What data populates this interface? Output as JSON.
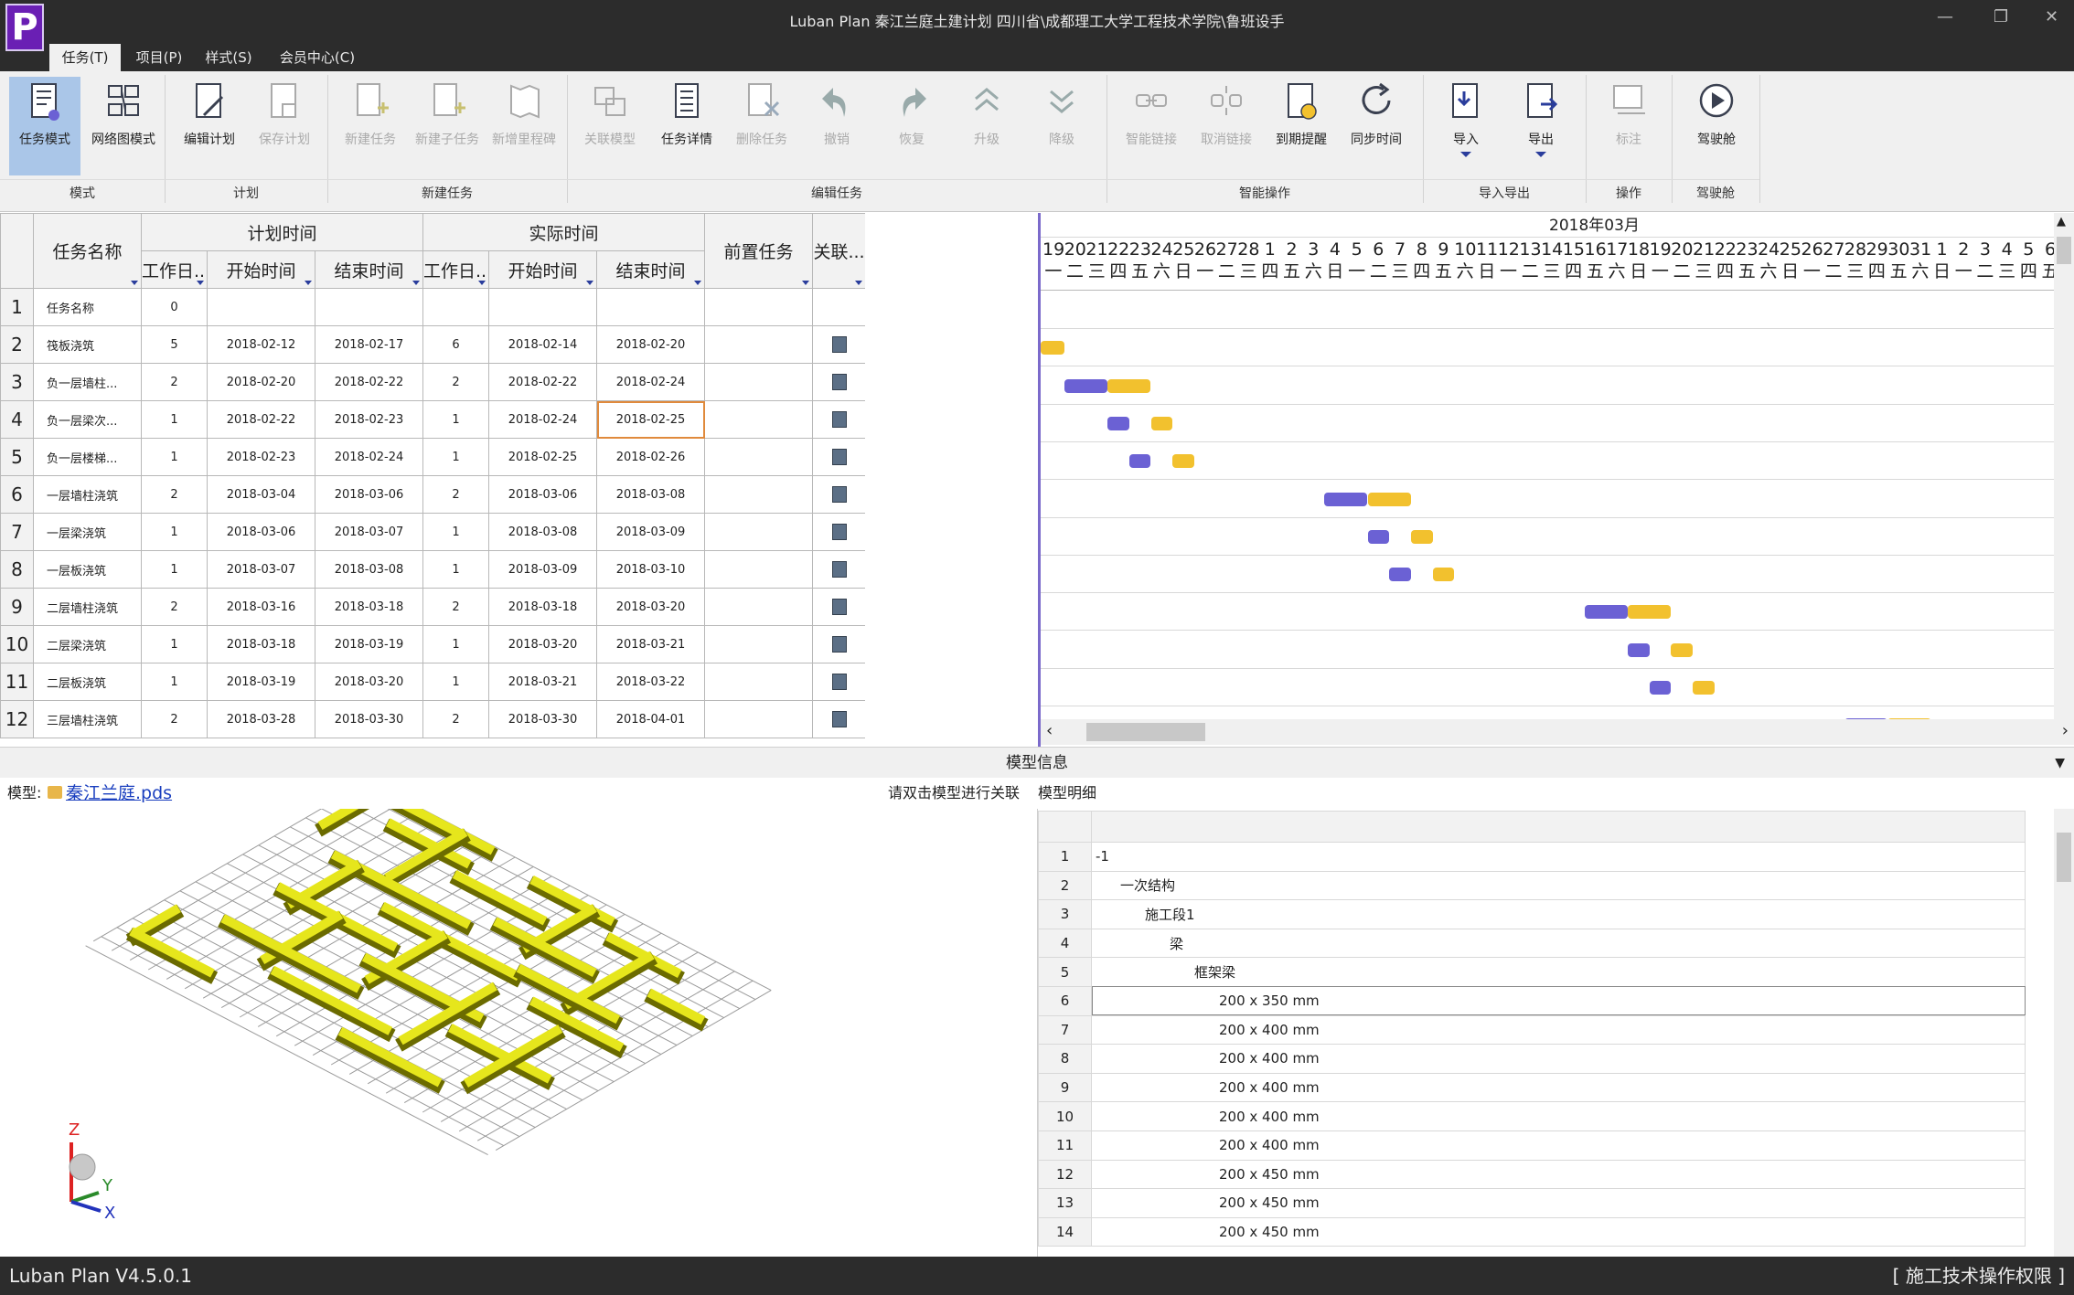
{
  "app": {
    "logo": "P",
    "title": "Luban Plan 秦江兰庭土建计划 四川省\\成都理工大学工程技术学院\\鲁班设手",
    "version": "Luban Plan V4.5.0.1",
    "permission": "[ 施工技术操作权限 ]"
  },
  "window_controls": {
    "minimize": "—",
    "restore": "❐",
    "close": "✕"
  },
  "menu": [
    {
      "label": "任务(T)",
      "active": true
    },
    {
      "label": "项目(P)",
      "active": false
    },
    {
      "label": "样式(S)",
      "active": false
    },
    {
      "label": "会员中心(C)",
      "active": false
    }
  ],
  "ribbon": {
    "buttons": [
      {
        "label": "任务模式",
        "icon": "task-mode-icon",
        "state": "selected"
      },
      {
        "label": "网络图模式",
        "icon": "network-mode-icon",
        "state": "normal"
      },
      {
        "label": "编辑计划",
        "icon": "edit-plan-icon",
        "state": "normal"
      },
      {
        "label": "保存计划",
        "icon": "save-plan-icon",
        "state": "disabled"
      },
      {
        "label": "新建任务",
        "icon": "new-task-icon",
        "state": "disabled"
      },
      {
        "label": "新建子任务",
        "icon": "new-subtask-icon",
        "state": "disabled"
      },
      {
        "label": "新增里程碑",
        "icon": "milestone-icon",
        "state": "disabled"
      },
      {
        "label": "关联模型",
        "icon": "link-model-icon",
        "state": "disabled"
      },
      {
        "label": "任务详情",
        "icon": "task-detail-icon",
        "state": "normal"
      },
      {
        "label": "删除任务",
        "icon": "delete-task-icon",
        "state": "disabled"
      },
      {
        "label": "撤销",
        "icon": "undo-icon",
        "state": "disabled"
      },
      {
        "label": "恢复",
        "icon": "redo-icon",
        "state": "disabled"
      },
      {
        "label": "升级",
        "icon": "promote-icon",
        "state": "disabled"
      },
      {
        "label": "降级",
        "icon": "demote-icon",
        "state": "disabled"
      },
      {
        "label": "智能链接",
        "icon": "smart-link-icon",
        "state": "disabled"
      },
      {
        "label": "取消链接",
        "icon": "unlink-icon",
        "state": "disabled"
      },
      {
        "label": "到期提醒",
        "icon": "due-reminder-icon",
        "state": "normal"
      },
      {
        "label": "同步时间",
        "icon": "sync-time-icon",
        "state": "normal"
      },
      {
        "label": "导入",
        "icon": "import-icon",
        "state": "normal",
        "dropdown": true
      },
      {
        "label": "导出",
        "icon": "export-icon",
        "state": "normal",
        "dropdown": true
      },
      {
        "label": "标注",
        "icon": "annotate-icon",
        "state": "disabled"
      },
      {
        "label": "驾驶舱",
        "icon": "cockpit-icon",
        "state": "normal"
      }
    ],
    "groups": [
      "模式",
      "计划",
      "新建任务",
      "编辑任务",
      "智能操作",
      "导入导出",
      "操作",
      "驾驶舱"
    ]
  },
  "table": {
    "headers": {
      "task_name": "任务名称",
      "plan_time": "计划时间",
      "actual_time": "实际时间",
      "work_days": "工作日...",
      "start_time": "开始时间",
      "end_time": "结束时间",
      "predecessor": "前置任务",
      "linked": "关联..."
    },
    "rows": [
      {
        "no": "1",
        "name": "任务名称",
        "plan_days": "0",
        "plan_start": "",
        "plan_end": "",
        "act_days": "",
        "act_start": "",
        "act_end": "",
        "pred": "",
        "linked": false
      },
      {
        "no": "2",
        "name": "筏板浇筑",
        "plan_days": "5",
        "plan_start": "2018-02-12",
        "plan_end": "2018-02-17",
        "act_days": "6",
        "act_start": "2018-02-14",
        "act_end": "2018-02-20",
        "pred": "",
        "linked": true
      },
      {
        "no": "3",
        "name": "负一层墙柱...",
        "plan_days": "2",
        "plan_start": "2018-02-20",
        "plan_end": "2018-02-22",
        "act_days": "2",
        "act_start": "2018-02-22",
        "act_end": "2018-02-24",
        "pred": "",
        "linked": true
      },
      {
        "no": "4",
        "name": "负一层梁次...",
        "plan_days": "1",
        "plan_start": "2018-02-22",
        "plan_end": "2018-02-23",
        "act_days": "1",
        "act_start": "2018-02-24",
        "act_end": "2018-02-25",
        "pred": "",
        "linked": true
      },
      {
        "no": "5",
        "name": "负一层楼梯...",
        "plan_days": "1",
        "plan_start": "2018-02-23",
        "plan_end": "2018-02-24",
        "act_days": "1",
        "act_start": "2018-02-25",
        "act_end": "2018-02-26",
        "pred": "",
        "linked": true
      },
      {
        "no": "6",
        "name": "一层墙柱浇筑",
        "plan_days": "2",
        "plan_start": "2018-03-04",
        "plan_end": "2018-03-06",
        "act_days": "2",
        "act_start": "2018-03-06",
        "act_end": "2018-03-08",
        "pred": "",
        "linked": true
      },
      {
        "no": "7",
        "name": "一层梁浇筑",
        "plan_days": "1",
        "plan_start": "2018-03-06",
        "plan_end": "2018-03-07",
        "act_days": "1",
        "act_start": "2018-03-08",
        "act_end": "2018-03-09",
        "pred": "",
        "linked": true
      },
      {
        "no": "8",
        "name": "一层板浇筑",
        "plan_days": "1",
        "plan_start": "2018-03-07",
        "plan_end": "2018-03-08",
        "act_days": "1",
        "act_start": "2018-03-09",
        "act_end": "2018-03-10",
        "pred": "",
        "linked": true
      },
      {
        "no": "9",
        "name": "二层墙柱浇筑",
        "plan_days": "2",
        "plan_start": "2018-03-16",
        "plan_end": "2018-03-18",
        "act_days": "2",
        "act_start": "2018-03-18",
        "act_end": "2018-03-20",
        "pred": "",
        "linked": true
      },
      {
        "no": "10",
        "name": "二层梁浇筑",
        "plan_days": "1",
        "plan_start": "2018-03-18",
        "plan_end": "2018-03-19",
        "act_days": "1",
        "act_start": "2018-03-20",
        "act_end": "2018-03-21",
        "pred": "",
        "linked": true
      },
      {
        "no": "11",
        "name": "二层板浇筑",
        "plan_days": "1",
        "plan_start": "2018-03-19",
        "plan_end": "2018-03-20",
        "act_days": "1",
        "act_start": "2018-03-21",
        "act_end": "2018-03-22",
        "pred": "",
        "linked": true
      },
      {
        "no": "12",
        "name": "三层墙柱浇筑",
        "plan_days": "2",
        "plan_start": "2018-03-28",
        "plan_end": "2018-03-30",
        "act_days": "2",
        "act_start": "2018-03-30",
        "act_end": "2018-04-01",
        "pred": "",
        "linked": true
      }
    ]
  },
  "gantt": {
    "month_label": "2018年03月",
    "days": [
      {
        "d": "19",
        "w": "一"
      },
      {
        "d": "20",
        "w": "二"
      },
      {
        "d": "21",
        "w": "三"
      },
      {
        "d": "22",
        "w": "四"
      },
      {
        "d": "23",
        "w": "五"
      },
      {
        "d": "24",
        "w": "六"
      },
      {
        "d": "25",
        "w": "日"
      },
      {
        "d": "26",
        "w": "一"
      },
      {
        "d": "27",
        "w": "二"
      },
      {
        "d": "28",
        "w": "三"
      },
      {
        "d": "1",
        "w": "四"
      },
      {
        "d": "2",
        "w": "五"
      },
      {
        "d": "3",
        "w": "六"
      },
      {
        "d": "4",
        "w": "日"
      },
      {
        "d": "5",
        "w": "一"
      },
      {
        "d": "6",
        "w": "二"
      },
      {
        "d": "7",
        "w": "三"
      },
      {
        "d": "8",
        "w": "四"
      },
      {
        "d": "9",
        "w": "五"
      },
      {
        "d": "10",
        "w": "六"
      },
      {
        "d": "11",
        "w": "日"
      },
      {
        "d": "12",
        "w": "一"
      },
      {
        "d": "13",
        "w": "二"
      },
      {
        "d": "14",
        "w": "三"
      },
      {
        "d": "15",
        "w": "四"
      },
      {
        "d": "16",
        "w": "五"
      },
      {
        "d": "17",
        "w": "六"
      },
      {
        "d": "18",
        "w": "日"
      },
      {
        "d": "19",
        "w": "一"
      },
      {
        "d": "20",
        "w": "二"
      },
      {
        "d": "21",
        "w": "三"
      },
      {
        "d": "22",
        "w": "四"
      },
      {
        "d": "23",
        "w": "五"
      },
      {
        "d": "24",
        "w": "六"
      },
      {
        "d": "25",
        "w": "日"
      },
      {
        "d": "26",
        "w": "一"
      },
      {
        "d": "27",
        "w": "二"
      },
      {
        "d": "28",
        "w": "三"
      },
      {
        "d": "29",
        "w": "四"
      },
      {
        "d": "30",
        "w": "五"
      },
      {
        "d": "31",
        "w": "六"
      },
      {
        "d": "1",
        "w": "日"
      },
      {
        "d": "2",
        "w": "一"
      },
      {
        "d": "3",
        "w": "二"
      },
      {
        "d": "4",
        "w": "三"
      },
      {
        "d": "5",
        "w": "四"
      },
      {
        "d": "6",
        "w": "五"
      }
    ],
    "colors": {
      "plan": "#6b61d4",
      "actual": "#f2c12e",
      "timeline": "#7b6acb"
    }
  },
  "model": {
    "section_title": "模型信息",
    "label": "模型:",
    "file": "秦江兰庭.pds",
    "hint": "请双击模型进行关联",
    "detail_title": "模型明细",
    "axes": {
      "z": "Z",
      "y": "Y",
      "x": "X"
    },
    "tree": [
      {
        "no": "1",
        "text": "-1",
        "indent": 0
      },
      {
        "no": "2",
        "text": "一次结构",
        "indent": 1
      },
      {
        "no": "3",
        "text": "施工段1",
        "indent": 2
      },
      {
        "no": "4",
        "text": "梁",
        "indent": 3
      },
      {
        "no": "5",
        "text": "框架梁",
        "indent": 4
      },
      {
        "no": "6",
        "text": "200 x 350 mm",
        "indent": 5
      },
      {
        "no": "7",
        "text": "200 x 400 mm",
        "indent": 5
      },
      {
        "no": "8",
        "text": "200 x 400 mm",
        "indent": 5
      },
      {
        "no": "9",
        "text": "200 x 400 mm",
        "indent": 5
      },
      {
        "no": "10",
        "text": "200 x 400 mm",
        "indent": 5
      },
      {
        "no": "11",
        "text": "200 x 400 mm",
        "indent": 5
      },
      {
        "no": "12",
        "text": "200 x 450 mm",
        "indent": 5
      },
      {
        "no": "13",
        "text": "200 x 450 mm",
        "indent": 5
      },
      {
        "no": "14",
        "text": "200 x 450 mm",
        "indent": 5
      }
    ]
  }
}
